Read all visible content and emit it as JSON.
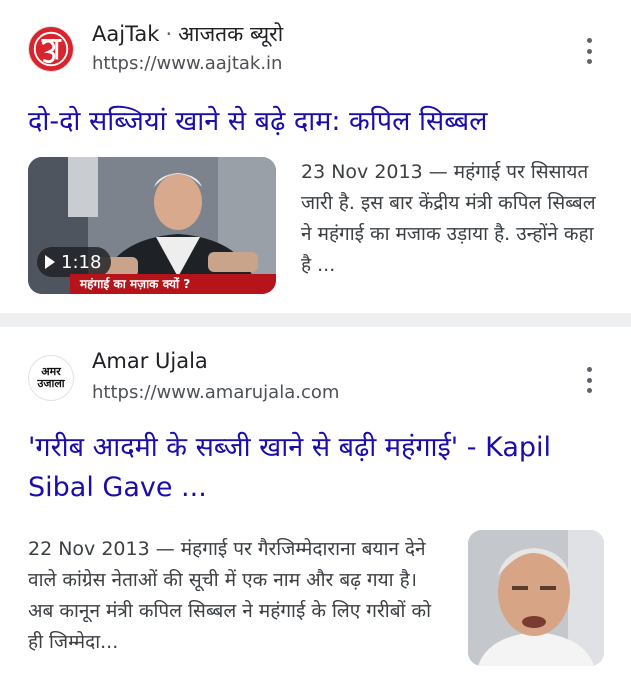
{
  "results": [
    {
      "favicon_icon": "aajtak-logo-icon",
      "site_name": "AajTak",
      "separator": "·",
      "publisher": "आजतक ब्यूरो",
      "url": "https://www.aajtak.in",
      "title": "दो-दो सब्जियां खाने से बढ़े दाम: कपिल सिब्बल",
      "video_duration": "1:18",
      "video_caption": "महंगाई का मज़ाक क्यों ?",
      "date": "23 Nov 2013",
      "dash": "—",
      "snippet": "महंगाई पर सिसायत जारी है. इस बार केंद्रीय मंत्री कपिल सिब्बल ने महंगाई का मजाक उड़ाया है. उन्होंने कहा है ..."
    },
    {
      "favicon_icon": "amar-ujala-logo-icon",
      "favicon_text_top": "अमर",
      "favicon_text_bottom": "उजाला",
      "site_name": "Amar Ujala",
      "url": "https://www.amarujala.com",
      "title": "'गरीब आदमी के सब्जी खाने से बढ़ी महंगाई' - Kapil Sibal Gave ...",
      "date": "22 Nov 2013",
      "dash": "—",
      "snippet": "मंहगाई पर गैरजिम्मेदाराना बयान देने वाले कांग्रेस नेताओं की सूची में एक नाम और बढ़ गया है। अब कानून मंत्री कपिल सिब्बल ने महंगाई के लिए गरीबों को ही जिम्मेदा..."
    }
  ],
  "icons": {
    "menu": "more-vert-icon",
    "play": "play-icon"
  },
  "colors": {
    "title_link": "#1a0dab",
    "aajtak_red": "#d9232d",
    "divider": "#eeeff1"
  }
}
